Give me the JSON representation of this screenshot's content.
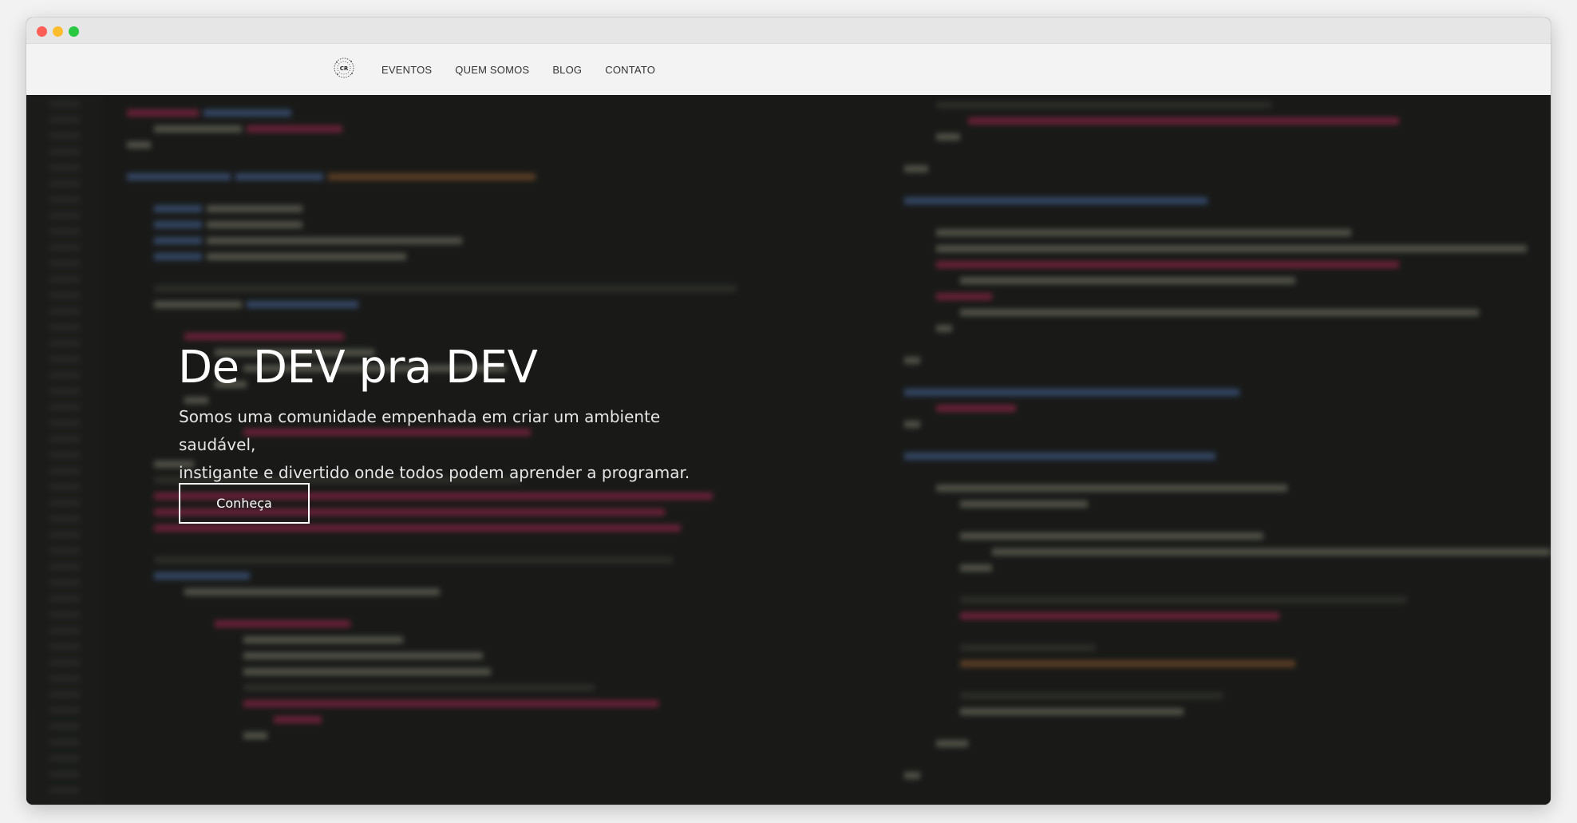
{
  "nav": {
    "logo_text": "CR",
    "links": [
      "EVENTOS",
      "QUEM SOMOS",
      "BLOG",
      "CONTATO"
    ]
  },
  "hero": {
    "title": "De DEV pra DEV",
    "text_line1": "Somos uma comunidade empenhada em criar um ambiente saudável,",
    "text_line2": "instigante e divertido onde todos podem aprender a programar.",
    "button": "Conheça"
  },
  "colors": {
    "window_bg": "#f2f2f2",
    "navbar_bg": "#f3f3f3",
    "hero_bg": "#1b1c1a",
    "text_primary": "#ffffff",
    "nav_text": "#333333"
  },
  "icons": {
    "close": "close-dot-icon",
    "minimize": "minimize-dot-icon",
    "maximize": "maximize-dot-icon",
    "logo": "cr-logo-icon"
  }
}
